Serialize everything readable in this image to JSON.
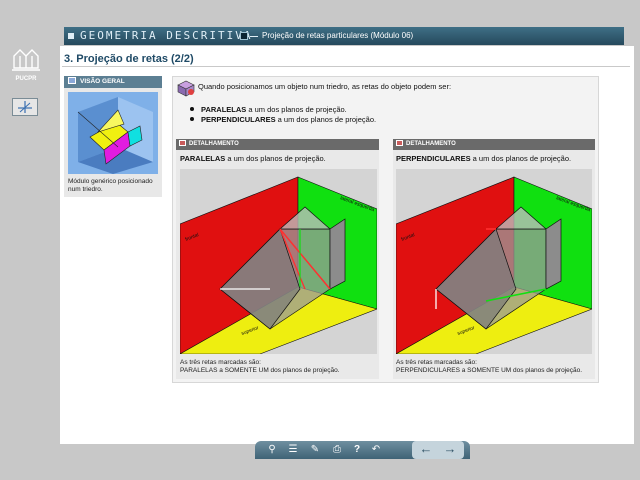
{
  "header": {
    "app_title": "GEOMETRIA DESCRITIVA",
    "module_title": "Projeção de retas particulares (Módulo 06)"
  },
  "logo": {
    "text": "PUCPR"
  },
  "page": {
    "title": "3. Projeção de retas (2/2)"
  },
  "visao_geral": {
    "label": "VISÃO GERAL",
    "caption": "Módulo genérico posicionado num triedro."
  },
  "intro": {
    "text": "Quando posicionamos um objeto num triedro, as retas do objeto podem ser:",
    "bullets": [
      {
        "strong": "PARALELAS",
        "rest": " a um dos planos de projeção."
      },
      {
        "strong": "PERPENDICULARES",
        "rest": " a um dos planos de projeção."
      }
    ]
  },
  "detalhamento": [
    {
      "label": "DETALHAMENTO",
      "strong": "PARALELAS",
      "rest": " a um dos planos de projeção.",
      "caption_line1": "As três retas marcadas são:",
      "caption_line2": "PARALELAS a SOMENTE UM dos planos de projeção.",
      "plane_labels": {
        "left": "frontal",
        "right": "lateral esquerda",
        "bottom": "superior"
      }
    },
    {
      "label": "DETALHAMENTO",
      "strong": "PERPENDICULARES",
      "rest": " a um dos planos de projeção.",
      "caption_line1": "As três retas marcadas são:",
      "caption_line2": "PERPENDICULARES a SOMENTE UM dos planos de projeção.",
      "plane_labels": {
        "left": "frontal",
        "right": "lateral esquerda",
        "bottom": "superior"
      }
    }
  ],
  "footer": {
    "tools": [
      "search-icon",
      "list-icon",
      "pencil-icon",
      "print-icon",
      "help-icon",
      "back-icon"
    ],
    "nav": [
      "previous-arrow-icon",
      "next-arrow-icon"
    ]
  },
  "colors": {
    "header_bg": "#2f5a70",
    "plane_red": "#e01010",
    "plane_green": "#10e010",
    "plane_yellow": "#eeee10",
    "line_highlight": "#ff3030"
  }
}
